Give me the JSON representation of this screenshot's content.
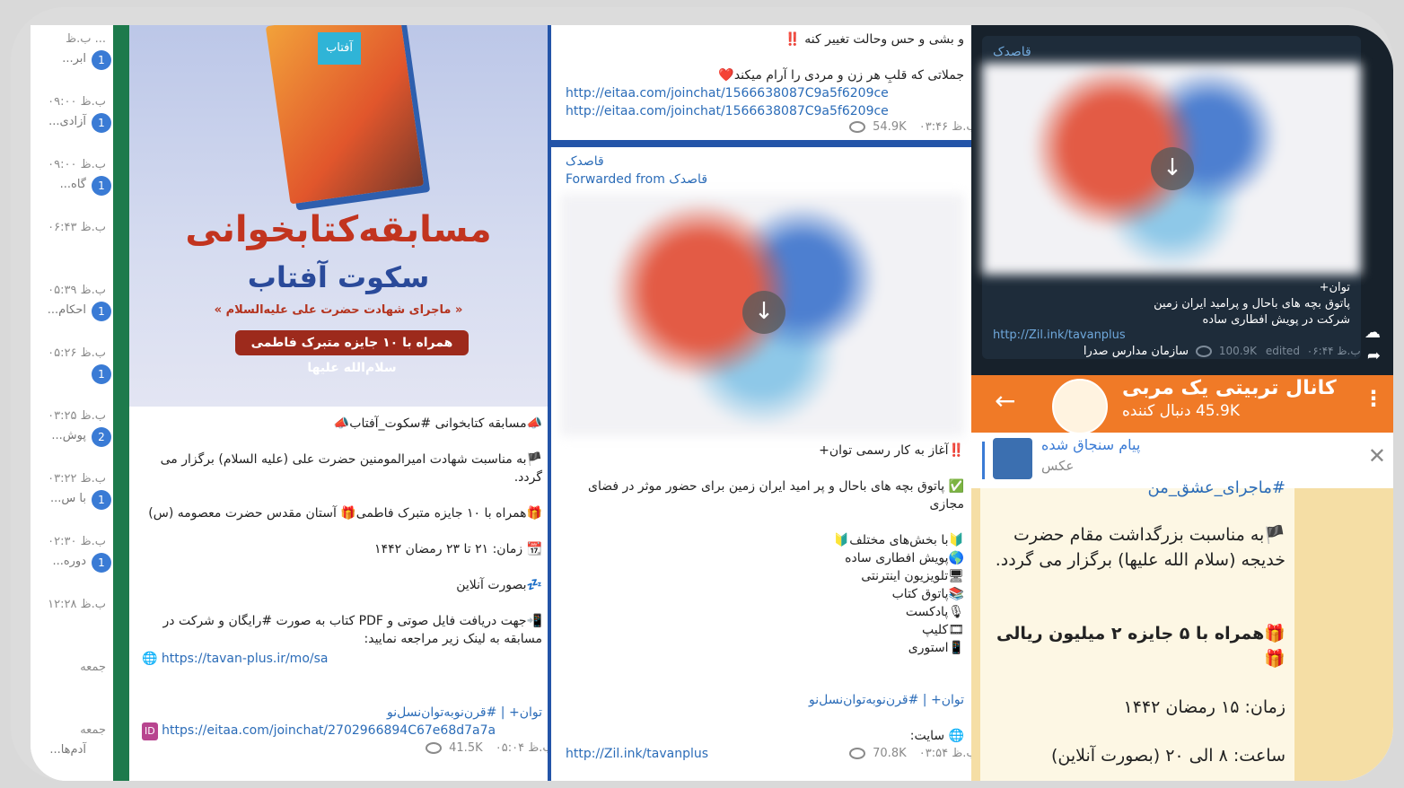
{
  "chat_list": [
    {
      "time": "ب.ظ ...",
      "snippet": "...ابر",
      "badge": "1"
    },
    {
      "time": "ب.ظ ۰۹:۰۰",
      "snippet": "...آزادی",
      "badge": "1"
    },
    {
      "time": "ب.ظ ۰۹:۰۰",
      "snippet": "...گاه",
      "badge": "1"
    },
    {
      "time": "ب.ظ ۰۶:۴۳",
      "snippet": "",
      "badge": ""
    },
    {
      "time": "ب.ظ ۰۵:۳۹",
      "snippet": "...احکام",
      "badge": "1"
    },
    {
      "time": "ب.ظ ۰۵:۲۶",
      "snippet": "",
      "badge": "1"
    },
    {
      "time": "ب.ظ ۰۳:۲۵",
      "snippet": "...پوش",
      "badge": "2"
    },
    {
      "time": "ب.ظ ۰۳:۲۲",
      "snippet": "...با س",
      "badge": "1"
    },
    {
      "time": "ب.ظ ۰۲:۳۰",
      "snippet": "...دوره",
      "badge": "1"
    },
    {
      "time": "ب.ظ ۱۲:۲۸",
      "snippet": "",
      "badge": ""
    },
    {
      "time": "جمعه",
      "snippet": "",
      "badge": ""
    },
    {
      "time": "جمعه",
      "snippet": "...آدم‌ها",
      "badge": ""
    }
  ],
  "col1": {
    "poster": {
      "book_tag": "آفتاب",
      "title": "مسابقه‌کتابخوانی",
      "subtitle": "سکوت آفتاب",
      "note": "« ماجرای شهادت حضرت علی علیه‌السلام »",
      "ribbon": "همراه با ۱۰ جایزه متبرک فاطمی سلام‌الله علیها"
    },
    "lines": [
      "📣مسابقه کتابخوانی #سکوت_آفتاب📣",
      "🏴به مناسبت شهادت امیرالمومنین حضرت علی (علیه السلام) برگزار می گردد.",
      "🎁همراه با ۱۰ جایزه متبرک فاطمی🎁 آستان مقدس حضرت معصومه (س)",
      "📆 زمان: ۲۱ تا ۲۳ رمضان ۱۴۴۲",
      "💤بصورت آنلاین",
      "📲جهت دریافت فایل صوتی و PDF کتاب به صورت #رایگان و شرکت در مسابقه به لینک زیر مراجعه نمایید:"
    ],
    "link1": "https://tavan-plus.ir/mo/sa",
    "tag_line": "توان+ | #قرن‌نوبه‌توان‌نسل‌نو",
    "link2": "https://eitaa.com/joinchat/2702966894C67e68d7a7a",
    "views": "41.5K",
    "time": "ب.ظ ۰۵:۰۴"
  },
  "col2": {
    "top_text1": "و بشی و حس وحالت تغییر کنه ‼️",
    "top_text2": "جملاتی که قلبِ هر زن و مردی را آرام میکند❤️",
    "top_link1": "http://eitaa.com/joinchat/1566638087C9a5f6209ce",
    "top_link2": "http://eitaa.com/joinchat/1566638087C9a5f6209ce",
    "top_views": "54.9K",
    "top_time": "ب.ظ ۰۳:۴۶",
    "sender": "قاصدک",
    "forwarded": "Forwarded from قاصدک",
    "lines": [
      "‼️آغاز به کار رسمی توان+",
      "✅ پاتوق بچه های باحال و پر امید ایران زمین برای حضور موثر در فضای مجازی",
      "🔰با بخش‌های مختلف🔰",
      "🌎پویش افطاری ساده",
      "🖥تلویزیون اینترنتی",
      "📚پاتوق کتاب",
      "🎙پادکست",
      "🎞کلیپ",
      "📱استوری"
    ],
    "tag_line": "توان+ | #قرن‌نوبه‌توان‌نسل‌نو",
    "site": "🌐 سایت:",
    "link": "http://Zil.ink/tavanplus",
    "views": "70.8K",
    "time": "ب.ظ ۰۳:۵۴"
  },
  "col3": {
    "sender": "قاصدک",
    "text_lines": [
      "توان+",
      "پاتوق بچه های باحال و پرامید ایران زمین",
      "شرکت در پویش افطاری ساده"
    ],
    "link": "http://Zil.ink/tavanplus",
    "org": "سازمان مدارس صدرا",
    "views": "100.9K",
    "edited": "edited",
    "time": "ب.ظ ۰۶:۴۴",
    "channel_title": "کانال تربیتی یک مربی",
    "followers": "45.9K دنبال کننده",
    "pinned_title": "پیام سنجاق شده",
    "pinned_sub": "عکس",
    "y_lines": [
      "#ماجرای_عشق_من",
      "🏴به مناسبت بزرگداشت مقام حضرت خدیجه (سلام الله علیها) برگزار می گردد.",
      "🎁همراه با ۵ جایزه ۲ میلیون ریالی 🎁",
      "زمان: ۱۵ رمضان ۱۴۴۲",
      "ساعت: ۸ الی ۲۰ (بصورت آنلاین)"
    ]
  }
}
